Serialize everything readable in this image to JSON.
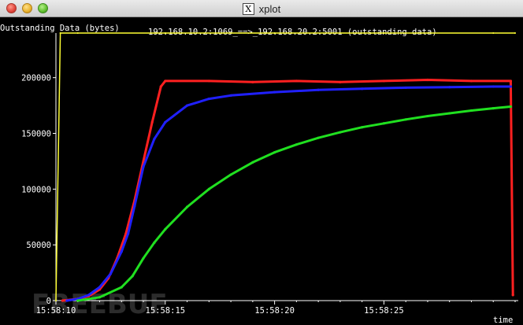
{
  "window": {
    "title": "xplot",
    "icon": "x-window-icon"
  },
  "chart_data": {
    "type": "line",
    "title": "192.168.10.2:1069_==>_192.168.20.2:5001 (outstanding data)",
    "ylabel": "Outstanding Data (bytes)",
    "xlabel": "time",
    "ylim": [
      0,
      240000
    ],
    "xlim": [
      0,
      21
    ],
    "x_tick_labels": [
      "15:58:10",
      "15:58:15",
      "15:58:20",
      "15:58:25"
    ],
    "x_tick_values": [
      0,
      5,
      10,
      15
    ],
    "y_tick_labels": [
      "0",
      "50000",
      "100000",
      "150000",
      "200000"
    ],
    "y_tick_values": [
      0,
      50000,
      100000,
      150000,
      200000
    ],
    "grid": false,
    "legend": "none",
    "background": "#000000",
    "series": [
      {
        "color": "#ffff33",
        "x": [
          0.0,
          0.2,
          1.0,
          5.0,
          10.0,
          15.0,
          20.0,
          21.0
        ],
        "y": [
          0,
          240000,
          240000,
          240000,
          240000,
          240000,
          240000,
          240000
        ]
      },
      {
        "color": "#ff2020",
        "x": [
          0.3,
          1.0,
          1.5,
          2.0,
          2.4,
          2.8,
          3.2,
          3.6,
          4.0,
          4.4,
          4.8,
          5.0,
          7.0,
          9.0,
          11.0,
          13.0,
          15.0,
          17.0,
          19.0,
          20.8,
          20.9
        ],
        "y": [
          0,
          1500,
          4000,
          10000,
          20000,
          38000,
          60000,
          90000,
          125000,
          160000,
          192000,
          197000,
          197000,
          196000,
          197000,
          196000,
          197000,
          198000,
          197000,
          197000,
          5000
        ]
      },
      {
        "color": "#2020ff",
        "x": [
          0.5,
          1.0,
          1.5,
          2.0,
          2.5,
          3.0,
          3.3,
          3.6,
          4.0,
          4.5,
          5.0,
          6.0,
          7.0,
          8.0,
          10.0,
          12.0,
          14.0,
          16.0,
          18.0,
          20.0,
          20.8
        ],
        "y": [
          0,
          1500,
          5000,
          12000,
          24000,
          44000,
          60000,
          85000,
          120000,
          145000,
          160000,
          175000,
          181000,
          184000,
          187000,
          189000,
          190000,
          191000,
          191500,
          192000,
          192000
        ]
      },
      {
        "color": "#20e020",
        "x": [
          1.0,
          2.0,
          3.0,
          3.5,
          4.0,
          4.5,
          5.0,
          6.0,
          7.0,
          8.0,
          9.0,
          10.0,
          11.0,
          12.0,
          13.0,
          14.0,
          15.0,
          16.0,
          17.0,
          18.0,
          19.0,
          20.0,
          20.8
        ],
        "y": [
          0,
          3000,
          12000,
          22000,
          38000,
          52000,
          64000,
          84000,
          100000,
          113000,
          124000,
          133000,
          140000,
          146000,
          151000,
          155500,
          159000,
          162500,
          165500,
          168000,
          170500,
          172500,
          174000
        ]
      }
    ]
  },
  "watermark": "FREEBUF"
}
